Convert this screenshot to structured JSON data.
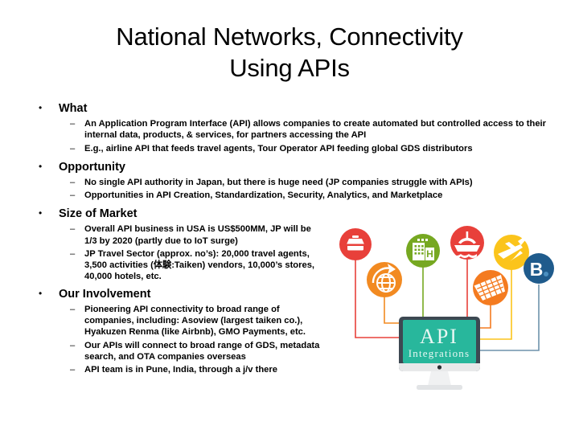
{
  "slide": {
    "title": "National Networks, Connectivity Using APIs",
    "title_line1": "National Networks, Connectivity",
    "title_line2": "Using APIs",
    "bullet_marker": "•",
    "dash_marker": "–"
  },
  "sections": [
    {
      "heading": "What",
      "items": [
        "An Application Program Interface (API) allows companies to create automated but controlled access to their internal data, products, & services, for partners accessing the API",
        "E.g., airline API that feeds travel agents, Tour Operator API feeding global GDS distributors"
      ]
    },
    {
      "heading": "Opportunity",
      "items": [
        "No single API authority in Japan, but there is huge need (JP companies struggle with APIs)",
        "Opportunities in API Creation, Standardization, Security, Analytics, and Marketplace"
      ]
    },
    {
      "heading": "Size of Market",
      "items": [
        "Overall API business in USA is US$500MM, JP will be 1/3 by 2020 (partly due to IoT surge)",
        "JP Travel Sector (approx. no’s): 20,000 travel agents, 3,500 activities (体験:Taiken) vendors, 10,000’s stores, 40,000 hotels, etc."
      ]
    },
    {
      "heading": "Our Involvement",
      "items": [
        "Pioneering API connectivity to broad range of companies, including: Asoview (largest taiken co.), Hyakuzen Renma (like Airbnb), GMO Payments, etc.",
        "Our APIs will connect to broad range of GDS, metadata search, and OTA companies overseas",
        "API team is in Pune, India, through a j/v there"
      ]
    }
  ],
  "illustration": {
    "monitor_title": "API",
    "monitor_subtitle": "Integrations",
    "screen_color": "#28B79C",
    "bezel_color": "#3D4852",
    "stand_color": "#E8E9EA",
    "nodes": [
      {
        "icon": "taxi-icon",
        "color": "#E8403A"
      },
      {
        "icon": "globe-plane-icon",
        "color": "#F28A21"
      },
      {
        "icon": "hotel-icon",
        "color": "#76A821"
      },
      {
        "icon": "ship-icon",
        "color": "#E8403A"
      },
      {
        "icon": "ticket-icon",
        "color": "#F47B20"
      },
      {
        "icon": "airplane-icon",
        "color": "#FBC41B"
      },
      {
        "icon": "booking-b-icon",
        "color": "#1F5B8C",
        "label": "B."
      }
    ]
  }
}
